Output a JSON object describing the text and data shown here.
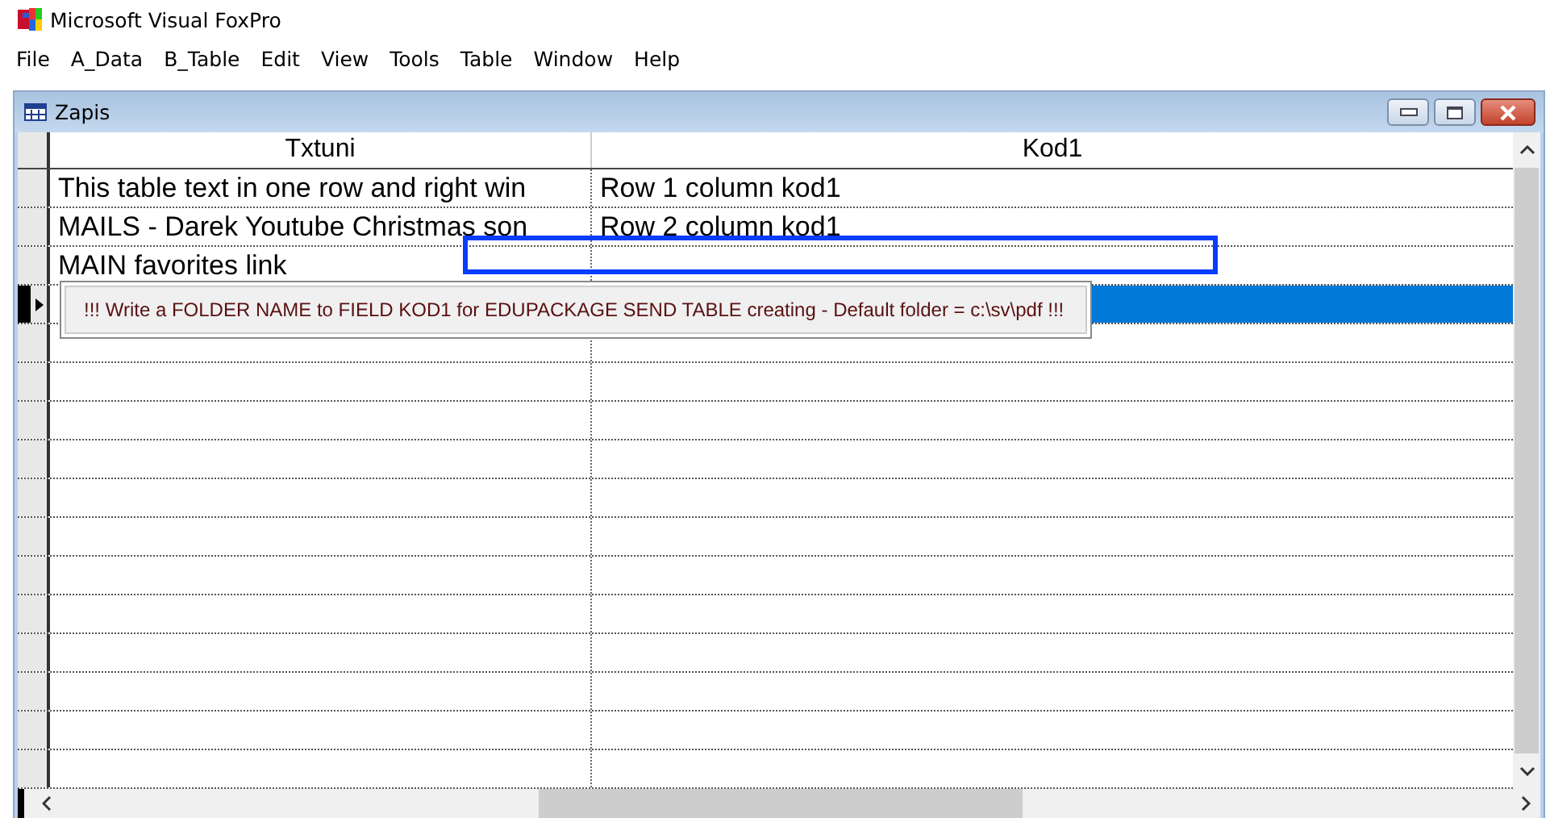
{
  "app": {
    "title": "Microsoft Visual FoxPro"
  },
  "menu": [
    "File",
    "A_Data",
    "B_Table",
    "Edit",
    "View",
    "Tools",
    "Table",
    "Window",
    "Help"
  ],
  "window": {
    "title": "Zapis"
  },
  "table": {
    "columns": [
      "Txtuni",
      "Kod1"
    ],
    "rows": [
      {
        "txtuni": "This table text in one row and right win",
        "kod1": "Row 1 column kod1",
        "selected": false
      },
      {
        "txtuni": "MAILS -  Darek Youtube Christmas son",
        "kod1": "Row 2 column kod1",
        "selected": false
      },
      {
        "txtuni": "MAIN favorites link",
        "selected": false
      },
      {
        "selected": true
      }
    ]
  },
  "tooltip": "!!!  Write a FOLDER NAME to FIELD KOD1 for EDUPACKAGE SEND TABLE creating  - Default folder = c:\\sv\\pdf !!!"
}
